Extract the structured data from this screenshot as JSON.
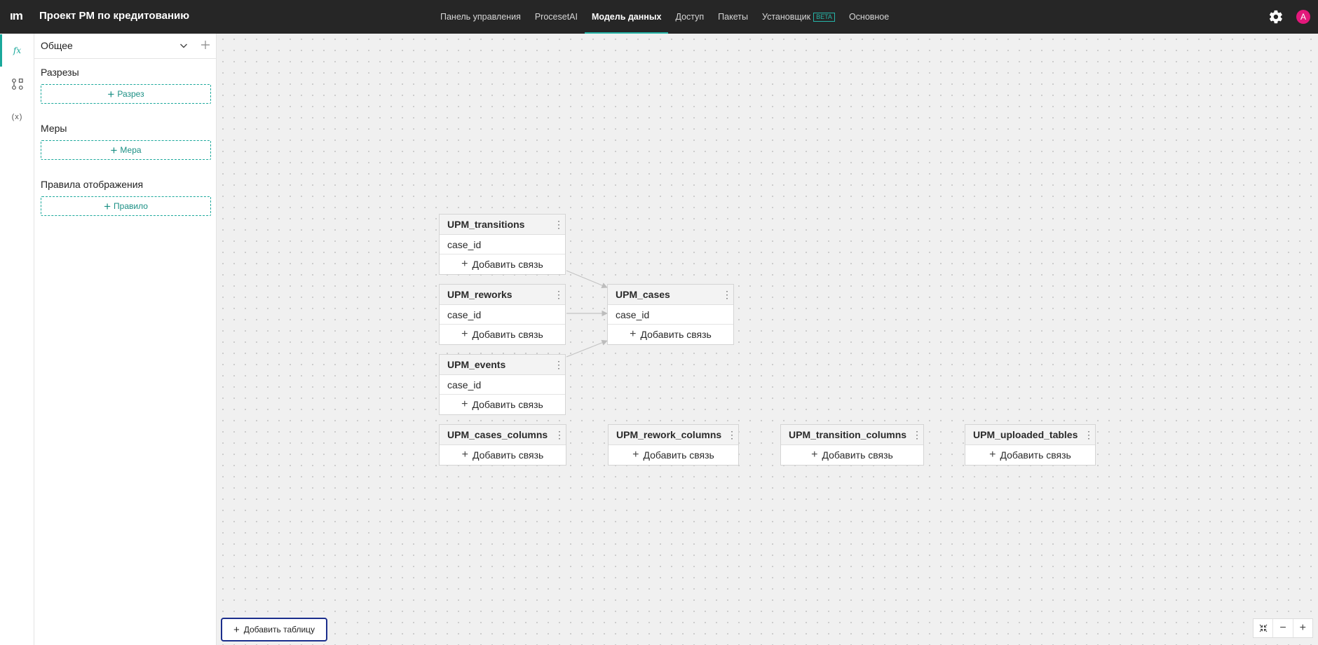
{
  "header": {
    "logo": "ım",
    "title": "Проект PM по кредитованию",
    "nav": [
      {
        "label": "Панель управления",
        "badge": ""
      },
      {
        "label": "ProcesetAI",
        "badge": ""
      },
      {
        "label": "Модель данных",
        "badge": ""
      },
      {
        "label": "Доступ",
        "badge": ""
      },
      {
        "label": "Пакеты",
        "badge": ""
      },
      {
        "label": "Установщик",
        "badge": "BETA"
      },
      {
        "label": "Основное",
        "badge": ""
      }
    ],
    "active_nav_index": 2,
    "user_initial": "A",
    "avatar_color": "#e3187b",
    "accent_color": "#26b5a8"
  },
  "rail": {
    "items": [
      {
        "icon": "function-icon",
        "glyph": "𝑓x",
        "active": true
      },
      {
        "icon": "schema-icon",
        "glyph": "",
        "active": false
      },
      {
        "icon": "variable-icon",
        "glyph": "(x)",
        "active": false
      }
    ]
  },
  "panel": {
    "title": "Общее",
    "sections": [
      {
        "label": "Разрезы",
        "button": "Разрез"
      },
      {
        "label": "Меры",
        "button": "Мера"
      },
      {
        "label": "Правила отображения",
        "button": "Правило"
      }
    ]
  },
  "canvas": {
    "add_link_label": "Добавить связь",
    "tables": [
      {
        "name": "UPM_transitions",
        "fields": [
          "case_id"
        ]
      },
      {
        "name": "UPM_reworks",
        "fields": [
          "case_id"
        ]
      },
      {
        "name": "UPM_events",
        "fields": [
          "case_id"
        ]
      },
      {
        "name": "UPM_cases",
        "fields": [
          "case_id"
        ]
      },
      {
        "name": "UPM_cases_columns",
        "fields": []
      },
      {
        "name": "UPM_rework_columns",
        "fields": []
      },
      {
        "name": "UPM_transition_columns",
        "fields": []
      },
      {
        "name": "UPM_uploaded_tables",
        "fields": []
      }
    ],
    "add_table_label": "Добавить таблицу"
  }
}
